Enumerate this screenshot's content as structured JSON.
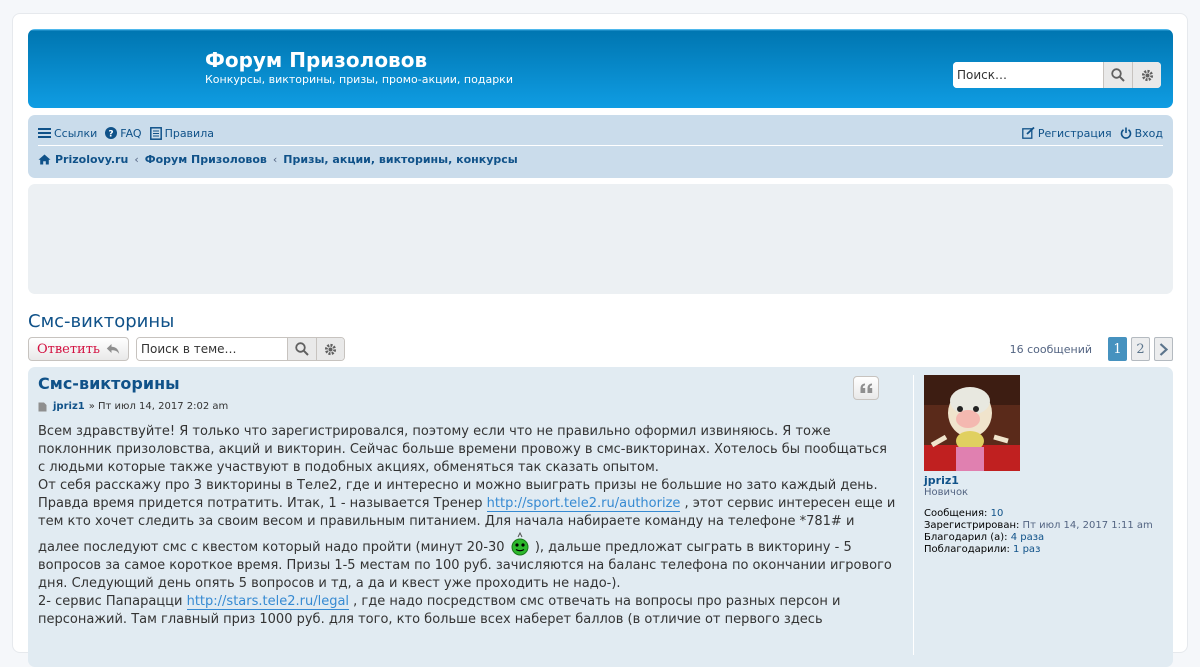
{
  "header": {
    "title": "Форум Призоловов",
    "description": "Конкурсы, викторины, призы, промо-акции, подарки",
    "search_placeholder": "Поиск…"
  },
  "nav": {
    "links": "Ссылки",
    "faq": "FAQ",
    "rules": "Правила",
    "register": "Регистрация",
    "login": "Вход",
    "breadcrumbs": [
      "Prizolovy.ru",
      "Форум Призоловов",
      "Призы, акции, викторины, конкурсы"
    ]
  },
  "topic": {
    "title": "Смс-викторины",
    "reply_label": "Ответить",
    "search_placeholder": "Поиск в теме…",
    "post_count": "16 сообщений",
    "pages": [
      "1",
      "2"
    ],
    "current_page": "1"
  },
  "post": {
    "subject": "Смс-викторины",
    "author": "jpriz1",
    "date": "» Пт июл 14, 2017 2:02 am",
    "p1": "Всем здравствуйте! Я только что зарегистрировался, поэтому если что не правильно оформил извиняюсь. Я тоже поклонник призоловства, акций и викторин. Сейчас больше времени провожу в смс-викторинах. Хотелось бы пообщаться с людьми которые также участвуют в подобных акциях, обменяться так сказать опытом.",
    "p2a": "От себя расскажу про 3 викторины в Теле2, где и интересно и можно выиграть призы не большие но зато каждый день. Правда время придется потратить. Итак, 1 - называется Тренер ",
    "link1": "http://sport.tele2.ru/authorize",
    "p2b": " , этот сервис интересен еще и тем кто хочет следить за своим весом и правильным питанием. Для начала набираете команду на телефоне *781# и далее последуют смс с квестом который надо пройти (минут 20-30 ",
    "p2c": " ), дальше предложат сыграть в викторину - 5 вопросов за самое короткое время. Призы 1-5 местам по 100 руб. зачисляются на баланс телефона по окончании игрового дня. Следующий день опять 5 вопросов и тд, а да и квест уже проходить не надо-).",
    "p3a": "2- сервис Папарацци ",
    "link2": "http://stars.tele2.ru/legal",
    "p3b": " , где надо посредством смс отвечать на вопросы про разных персон и персонажий. Там главный приз 1000 руб. для того, кто больше всех наберет баллов (в отличие от первого здесь"
  },
  "profile": {
    "username": "jpriz1",
    "rank": "Новичок",
    "posts_label": "Сообщения:",
    "posts_value": "10",
    "registered_label": "Зарегистрирован:",
    "registered_value": "Пт июл 14, 2017 1:11 am",
    "thanked_label": "Благодарил (а):",
    "thanked_value": "4 раза",
    "thanked_by_label": "Поблагодарили:",
    "thanked_by_value": "1 раз"
  },
  "colors": {
    "header_blue": "#12a3eb",
    "link_blue": "#105289",
    "nav_bg": "#cadceb",
    "post_bg": "#e1ebf2",
    "reply_red": "#d31141"
  }
}
